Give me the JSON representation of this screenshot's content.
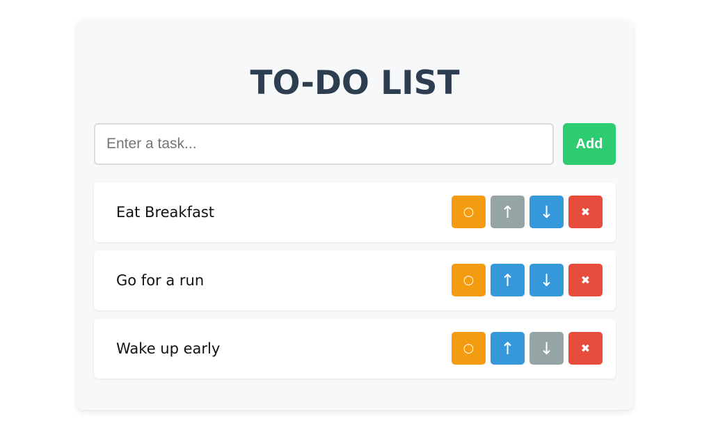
{
  "header": {
    "title": "TO-DO LIST"
  },
  "input": {
    "placeholder": "Enter a task...",
    "value": ""
  },
  "add_button": {
    "label": "Add"
  },
  "icons": {
    "toggle": "○",
    "up": "↑",
    "down": "↓",
    "delete": "✖"
  },
  "colors": {
    "toggle": "#f39c12",
    "active": "#3498db",
    "disabled": "#95a5a6",
    "delete": "#e74c3c",
    "add": "#2ecc71",
    "title": "#2c3e50"
  },
  "tasks": [
    {
      "text": "Eat Breakfast",
      "up_enabled": false,
      "down_enabled": true
    },
    {
      "text": "Go for a run",
      "up_enabled": true,
      "down_enabled": true
    },
    {
      "text": "Wake up early",
      "up_enabled": true,
      "down_enabled": false
    }
  ]
}
